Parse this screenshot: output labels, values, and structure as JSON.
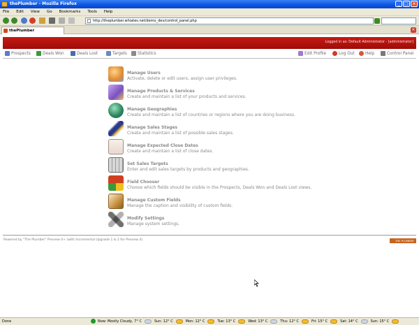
{
  "window": {
    "title": "thePlumber - Mozilla Firefox"
  },
  "menu": [
    "File",
    "Edit",
    "View",
    "Go",
    "Bookmarks",
    "Tools",
    "Help"
  ],
  "address": {
    "url": "http://theplumber.whiates.net/demo_dev/control_panel.php"
  },
  "tab": {
    "label": "thePlumber"
  },
  "header": {
    "login_info": "Logged in as: Default Administrator - [administrator]"
  },
  "nav": {
    "left": [
      "Prospects",
      "Deals Won",
      "Deals Lost",
      "Targets",
      "Statistics"
    ],
    "right": [
      "Edit Profile",
      "Log Out",
      "Help",
      "Control Panel"
    ]
  },
  "control_panel": {
    "items": [
      {
        "title": "Manage Users",
        "desc": "Activate, delete or edit users, assign user privileges.",
        "icon": "users-icon",
        "color": "#e08a30"
      },
      {
        "title": "Manage Products & Services",
        "desc": "Create and maintain a list of your products and services.",
        "icon": "product-box-icon",
        "color": "#7a50c0"
      },
      {
        "title": "Manage Geographies",
        "desc": "Create and maintain a list of countries or regions where you are doing business.",
        "icon": "globe-icon",
        "color": "#2f8a5a"
      },
      {
        "title": "Manage Sales Stages",
        "desc": "Create and maintain a list of possible sales stages.",
        "icon": "pen-icon",
        "color": "#2a3a8a"
      },
      {
        "title": "Manage Expected Close Dates",
        "desc": "Create and maintain a list of close dates.",
        "icon": "calendar-icon",
        "color": "#c85a5a"
      },
      {
        "title": "Set Sales Targets",
        "desc": "Enter and edit sales targets by products and geographies.",
        "icon": "calculator-icon",
        "color": "#8a8a8a"
      },
      {
        "title": "Field Chooser",
        "desc": "Choose which fields should be visible in the Prospects, Deals Won and Deals Lost views.",
        "icon": "blocks-icon",
        "color": "#d04020"
      },
      {
        "title": "Manage Custom Fields",
        "desc": "Manage the caption and visibility of custom fields.",
        "icon": "custom-fields-icon",
        "color": "#c89040"
      },
      {
        "title": "Modify Settings",
        "desc": "Manage system settings.",
        "icon": "tools-icon",
        "color": "#707070"
      }
    ]
  },
  "footer": {
    "text": "Powered by \"The Plumber\" Preview 4+ (with Incremental Upgrade 1 & 2 for Preview 4)",
    "badge": "THE PLUMBER"
  },
  "status": {
    "text": "Done",
    "forecast": [
      "Now: Mostly Cloudy, 7° C",
      "Sun: 12° C",
      "Mon: 12° C",
      "Tue: 13° C",
      "Wed: 13° C",
      "Thu: 12° C",
      "Fri: 15° C",
      "Sat: 14° C",
      "Sun: 15° C"
    ]
  }
}
